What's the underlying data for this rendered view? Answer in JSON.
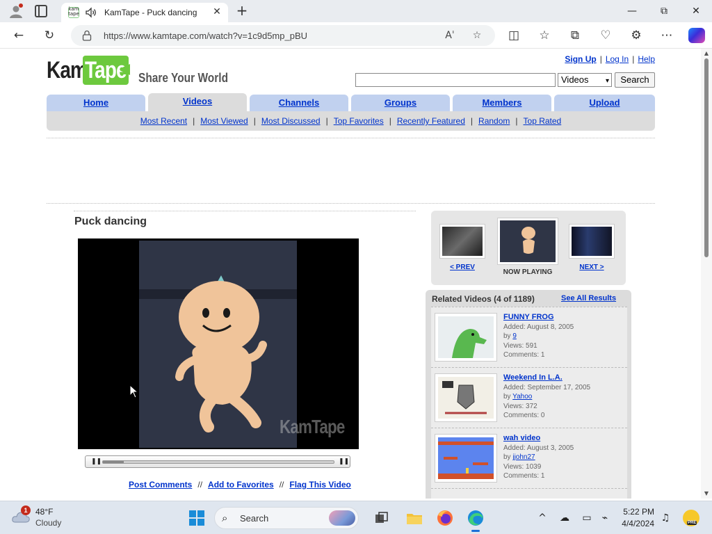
{
  "browser": {
    "tab_title": "KamTape - Puck dancing",
    "tab_favicon_text": "kam tape",
    "url": "https://www.kamtape.com/watch?v=1c9d5mp_pBU",
    "window_controls": {
      "minimize": "—",
      "restore": "⧉",
      "close": "✕"
    },
    "icons": [
      "profile-icon",
      "tab-actions-icon",
      "mute-icon",
      "close-tab-icon",
      "new-tab-icon",
      "back-icon",
      "refresh-icon",
      "lock-icon",
      "read-aloud-icon",
      "favorite-star-icon",
      "split-screen-icon",
      "favorites-icon",
      "collections-icon",
      "browser-essentials-icon",
      "extensions-icon",
      "more-icon",
      "copilot-icon"
    ]
  },
  "site": {
    "logo": {
      "kam": "Kam",
      "tape": "Tape"
    },
    "tagline": "Share Your World",
    "top_links": {
      "signup": "Sign Up",
      "login": "Log In",
      "help": "Help",
      "sep": "|"
    },
    "search": {
      "value": "",
      "category": "Videos",
      "button": "Search"
    },
    "nav_tabs": [
      {
        "label": "Home"
      },
      {
        "label": "Videos"
      },
      {
        "label": "Channels"
      },
      {
        "label": "Groups"
      },
      {
        "label": "Members"
      },
      {
        "label": "Upload"
      }
    ],
    "sub_nav": [
      "Most Recent",
      "Most Viewed",
      "Most Discussed",
      "Top Favorites",
      "Recently Featured",
      "Random",
      "Top Rated"
    ],
    "sub_nav_sep": "|"
  },
  "video": {
    "title": "Puck dancing",
    "watermark": "KamTape",
    "progress": 0.09,
    "links": {
      "comment": "Post Comments",
      "favorite": "Add to Favorites",
      "flag": "Flag This Video",
      "sep": "//"
    }
  },
  "now_playing": {
    "prev": "< PREV",
    "current": "NOW PLAYING",
    "next": "NEXT >"
  },
  "related": {
    "heading": "Related Videos (4 of 1189)",
    "see_all": "See All Results",
    "items": [
      {
        "title": "FUNNY FROG",
        "added": "Added: August 8, 2005",
        "by_label": "by",
        "by": "9",
        "views": "Views: 591",
        "comments": "Comments: 1"
      },
      {
        "title": "Weekend In L.A.",
        "added": "Added: September 17, 2005",
        "by_label": "by",
        "by": "Yahoo",
        "views": "Views: 372",
        "comments": "Comments: 0"
      },
      {
        "title": "wah video",
        "added": "Added: August 3, 2005",
        "by_label": "by",
        "by": "jjohn27",
        "views": "Views: 1039",
        "comments": "Comments: 1"
      }
    ]
  },
  "taskbar": {
    "weather_badge": "1",
    "temperature": "48°F",
    "condition": "Cloudy",
    "search_label": "Search",
    "time": "5:22 PM",
    "date": "4/4/2024",
    "pre_badge": "PRE"
  },
  "colors": {
    "link": "#0033cc",
    "nav_tab": "#c1d1ef",
    "nav_active": "#dcdcdc",
    "logo_green": "#6dc93e"
  }
}
